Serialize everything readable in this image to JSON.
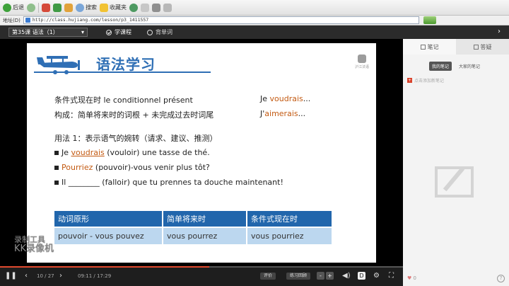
{
  "browser": {
    "back_label": "后退",
    "search_label": "搜索",
    "favorites_label": "收藏夹",
    "address_label": "地址(D)",
    "url": "http://class.hujiang.com/lesson/p3_1411557"
  },
  "course": {
    "lesson_title": "第35课 语法（1）",
    "tabs": [
      {
        "label": "学课程",
        "active": true
      },
      {
        "label": "背单词",
        "active": false
      }
    ]
  },
  "slide": {
    "title": "语法学习",
    "logo_text": "沪江法语",
    "line1": {
      "zh": "条件式现在时 le conditionnel présent",
      "example_prefix": "Je ",
      "example_hl": "voudrais",
      "example_suffix": "..."
    },
    "line2": {
      "zh": "构成：简单将来时的词根 + 未完成过去时词尾",
      "example_prefix": "J'",
      "example_hl": "aimerais",
      "example_suffix": "..."
    },
    "usage": "用法 1：表示语气的婉转（请求、建议、推测）",
    "bullets": [
      {
        "prefix": "Je ",
        "hl": "voudrais",
        "suffix": " (vouloir) une tasse de thé."
      },
      {
        "prefix": "",
        "hl": "Pourriez",
        "suffix": " (pouvoir)-vous venir plus tôt?"
      },
      {
        "prefix": "Il ________ (falloir) que tu prennes ta douche maintenant!",
        "hl": "",
        "suffix": ""
      }
    ],
    "table": {
      "headers": [
        "动词原形",
        "简单将来时",
        "条件式现在时"
      ],
      "row": [
        "pouvoir - vous pouvez",
        "vous pourrez",
        "vous pourriez"
      ]
    }
  },
  "watermark": {
    "line1": "录制工具",
    "line2": "KK录像机"
  },
  "player": {
    "page": "10 / 27",
    "time": "09:11 / 17:29",
    "progress": 0.52,
    "btn_review": "评价",
    "btn_exercise": "练习回顾",
    "btn_minus": "-",
    "btn_plus": "+",
    "btn_d": "D"
  },
  "panel": {
    "tab_notes": "笔记",
    "tab_qa": "答疑",
    "sub_mine": "我的笔记",
    "sub_all": "大家的笔记",
    "add_note": "点击添加新笔记",
    "likes": "0",
    "help": "?"
  },
  "colors": {
    "accent": "#2f6fb5",
    "highlight": "#c35a12",
    "table_header": "#2166ac",
    "table_cell": "#bcd7ef"
  }
}
